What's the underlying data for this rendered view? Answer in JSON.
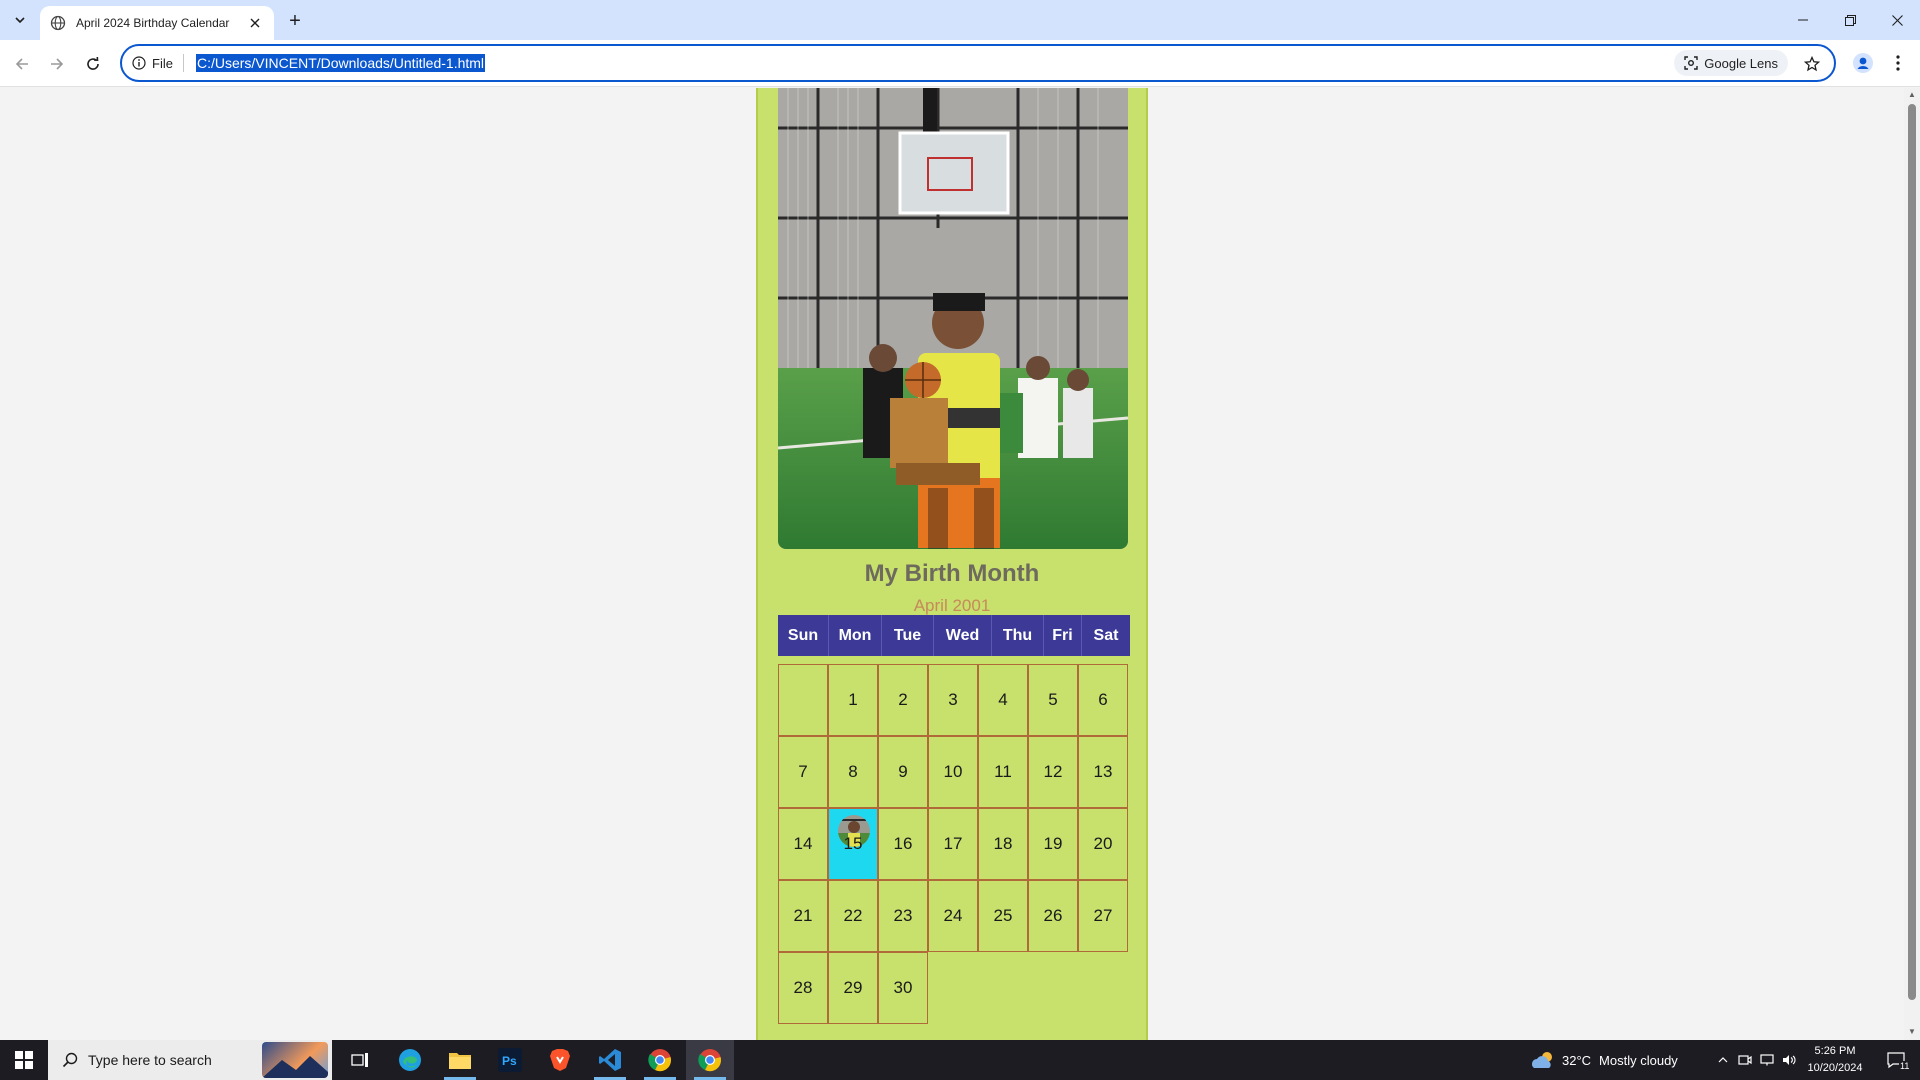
{
  "browser": {
    "tab_title": "April 2024 Birthday Calendar",
    "new_tab_symbol": "+",
    "omnibox": {
      "chip_label": "File",
      "url": "C:/Users/VINCENT/Downloads/Untitled-1.html",
      "lens_label": "Google Lens"
    }
  },
  "page": {
    "title": "My Birth Month",
    "subtitle": "April 2001",
    "weekdays": [
      "Sun",
      "Mon",
      "Tue",
      "Wed",
      "Thu",
      "Fri",
      "Sat"
    ],
    "weeks": [
      [
        "",
        "1",
        "2",
        "3",
        "4",
        "5",
        "6"
      ],
      [
        "7",
        "8",
        "9",
        "10",
        "11",
        "12",
        "13"
      ],
      [
        "14",
        "15",
        "16",
        "17",
        "18",
        "19",
        "20"
      ],
      [
        "21",
        "22",
        "23",
        "24",
        "25",
        "26",
        "27"
      ],
      [
        "28",
        "29",
        "30"
      ]
    ],
    "highlighted_day": "15",
    "colors": {
      "card_background": "#c8e06c",
      "header_background": "#3c3a96",
      "highlight": "#1ed8f0",
      "cell_border": "#b06a3a"
    }
  },
  "taskbar": {
    "search_placeholder": "Type here to search",
    "apps": [
      "task-view-icon",
      "edge-icon",
      "file-explorer-icon",
      "photoshop-icon",
      "brave-icon",
      "vscode-icon",
      "chrome-icon",
      "chrome-icon"
    ],
    "weather": {
      "temp": "32°C",
      "condition": "Mostly cloudy"
    },
    "time": "5:26 PM",
    "date": "10/20/2024",
    "notification_count": "11"
  }
}
